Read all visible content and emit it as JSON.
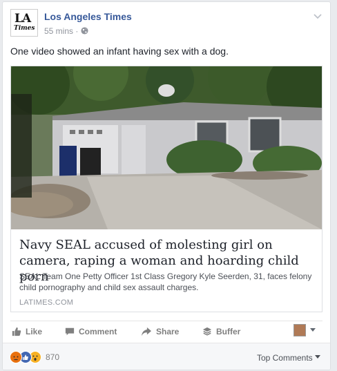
{
  "post": {
    "page_name": "Los Angeles Times",
    "avatar_text_top": "LA",
    "avatar_text_bottom": "Times",
    "time": "55 mins",
    "separator": "·",
    "privacy_icon": "globe-icon",
    "text": "One video showed an infant having sex with a dog."
  },
  "link": {
    "title": "Navy SEAL accused of molesting girl on camera, raping a woman and hoarding child porn",
    "description": "SEAL Team One Petty Officer 1st Class Gregory Kyle Seerden, 31, faces felony child pornography and child sex assault charges.",
    "domain": "LATIMES.COM"
  },
  "actions": {
    "like": "Like",
    "comment": "Comment",
    "share": "Share",
    "buffer": "Buffer"
  },
  "footer": {
    "reaction_icons": [
      "angry-reaction-icon",
      "like-reaction-icon",
      "wow-reaction-icon"
    ],
    "reaction_count": "870",
    "sort_label": "Top Comments"
  },
  "colors": {
    "link_blue": "#365899",
    "meta_gray": "#90949c",
    "like_blue": "#4267b2",
    "angry_orange": "#e9710f",
    "wow_yellow": "#f7b125"
  }
}
